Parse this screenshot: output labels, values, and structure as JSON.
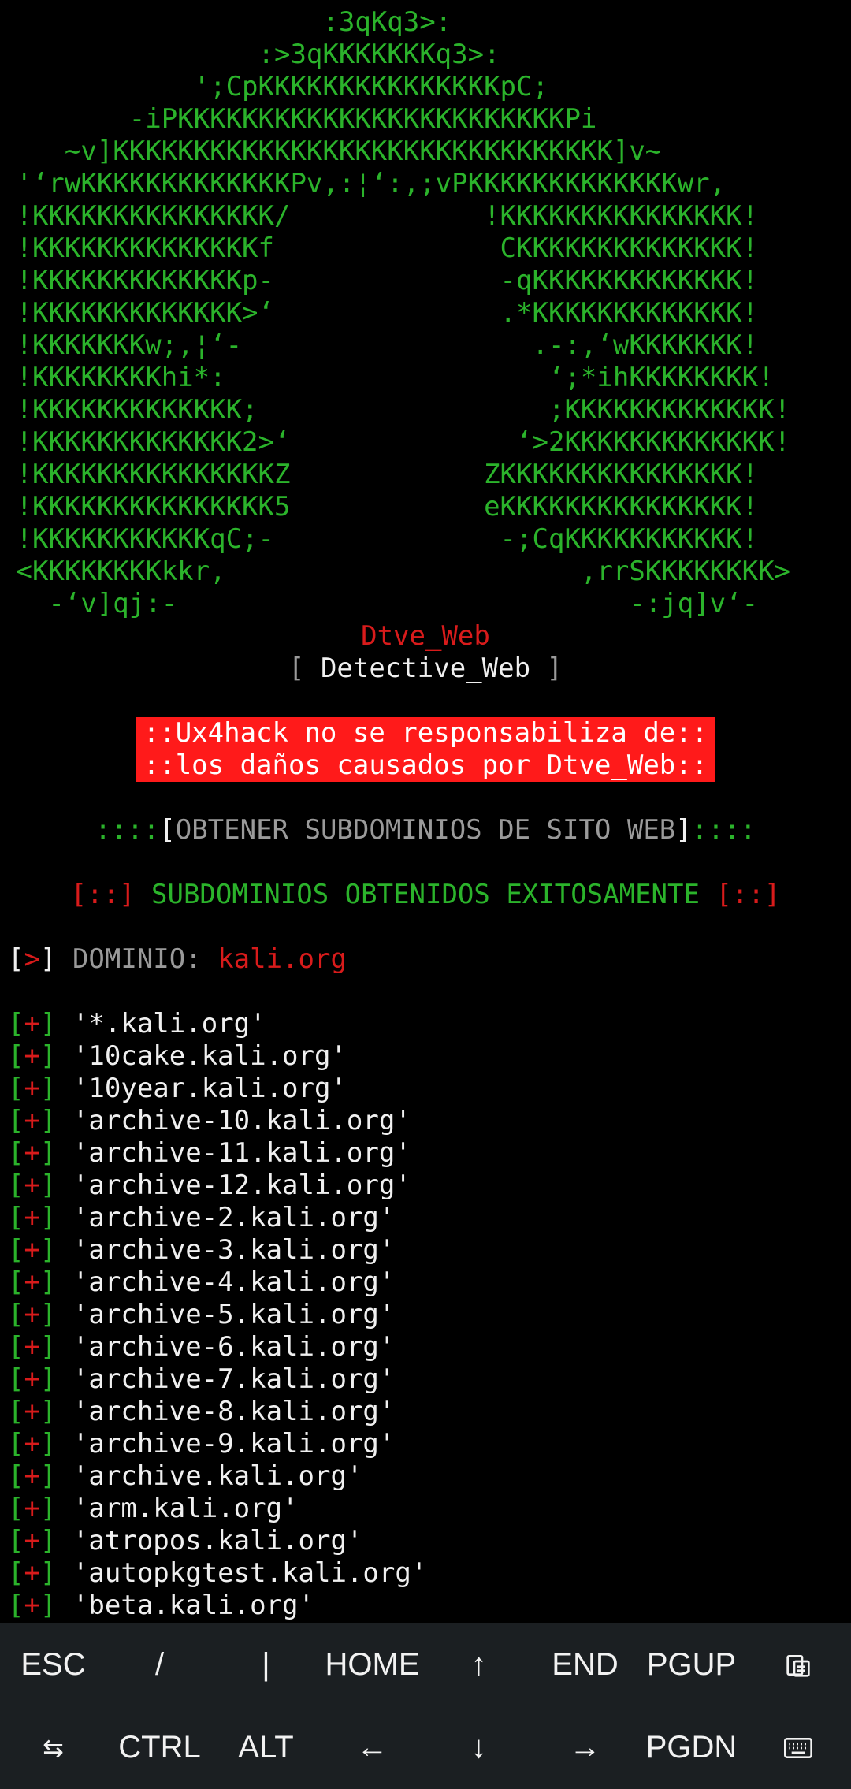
{
  "banner": {
    "art": [
      "                    :3qKq3>:",
      "                :>3qKKKKKKKq3>:",
      "            ';CpKKKKKKKKKKKKKKKpC;",
      "        -iPKKKKKKKKKKKKKKKKKKKKKKKKPi",
      "    ~v]KKKKKKKKKKKKKKKKKKKKKKKKKKKKKKK]v~",
      " '‘rwKKKKKKKKKKKKKPv,:¦‘:,;vPKKKKKKKKKKKKKwr,",
      " !KKKKKKKKKKKKKKK/            !KKKKKKKKKKKKKKK!",
      " !KKKKKKKKKKKKKKf              CKKKKKKKKKKKKKK!",
      " !KKKKKKKKKKKKKp-              -qKKKKKKKKKKKKK!",
      " !KKKKKKKKKKKKK>‘              .*KKKKKKKKKKKKK!",
      " !KKKKKKKw;,¦‘-                  .-:,‘wKKKKKKK!",
      " !KKKKKKKKhi*:                    ‘;*ihKKKKKKKK!",
      " !KKKKKKKKKKKKK;                  ;KKKKKKKKKKKKK!",
      " !KKKKKKKKKKKKK2>‘              ‘>2KKKKKKKKKKKKK!",
      " !KKKKKKKKKKKKKKKZ            ZKKKKKKKKKKKKKKK!",
      " !KKKKKKKKKKKKKKK5            eKKKKKKKKKKKKKKK!",
      " !KKKKKKKKKKKqC;-              -;CqKKKKKKKKKKK!",
      " <KKKKKKKKkkr,                      ,rrSKKKKKKKK>",
      "   -‘v]qj:-                            -:jq]v‘-"
    ],
    "tool_name": "Dtve_Web",
    "subtitle_open": "[ ",
    "subtitle": "Detective_Web",
    "subtitle_close": " ]"
  },
  "warning": {
    "line1": "::Ux4hack no se responsabiliza de::",
    "line2": "::los daños causados por Dtve_Web::"
  },
  "section": {
    "left_dots": "::::",
    "open_bracket": "[",
    "title": "OBTENER SUBDOMINIOS DE SITO WEB",
    "close_bracket": "]",
    "right_dots": "::::"
  },
  "result": {
    "left_marker": "[::]",
    "message": "SUBDOMINIOS OBTENIDOS EXITOSAMENTE",
    "right_marker": "[::]"
  },
  "domain": {
    "open_bracket": "[",
    "arrow": ">",
    "close_bracket": "]",
    "label": "DOMINIO:",
    "value": "kali.org"
  },
  "list_marker": {
    "open": "[",
    "plus": "+",
    "close": "]"
  },
  "subdomains": [
    "'*.kali.org'",
    "'10cake.kali.org'",
    "'10year.kali.org'",
    "'archive-10.kali.org'",
    "'archive-11.kali.org'",
    "'archive-12.kali.org'",
    "'archive-2.kali.org'",
    "'archive-3.kali.org'",
    "'archive-4.kali.org'",
    "'archive-5.kali.org'",
    "'archive-6.kali.org'",
    "'archive-7.kali.org'",
    "'archive-8.kali.org'",
    "'archive-9.kali.org'",
    "'archive.kali.org'",
    "'arm.kali.org'",
    "'atropos.kali.org'",
    "'autopkgtest.kali.org'",
    "'beta.kali.org'"
  ],
  "extra_keys": {
    "row1": [
      {
        "label": "ESC",
        "name": "esc-key"
      },
      {
        "label": "/",
        "name": "slash-key"
      },
      {
        "label": "|",
        "name": "pipe-key"
      },
      {
        "label": "HOME",
        "name": "home-key"
      },
      {
        "label": "↑",
        "name": "up-arrow-key"
      },
      {
        "label": "END",
        "name": "end-key"
      },
      {
        "label": "PGUP",
        "name": "pgup-key"
      },
      {
        "label": "",
        "name": "clipboard-paste-icon",
        "icon": "clipboard-paste"
      }
    ],
    "row2": [
      {
        "label": "⇆",
        "name": "tab-key-icon",
        "icon": "tab"
      },
      {
        "label": "CTRL",
        "name": "ctrl-key"
      },
      {
        "label": "ALT",
        "name": "alt-key"
      },
      {
        "label": "←",
        "name": "left-arrow-key"
      },
      {
        "label": "↓",
        "name": "down-arrow-key"
      },
      {
        "label": "→",
        "name": "right-arrow-key"
      },
      {
        "label": "PGDN",
        "name": "pgdn-key"
      },
      {
        "label": "",
        "name": "keyboard-toggle-icon",
        "icon": "keyboard"
      }
    ]
  },
  "colors": {
    "background": "#000000",
    "banner_green": "#2bb32b",
    "accent_red": "#d81b1b",
    "warning_bg": "#ff1a1a",
    "key_bar_bg": "#1b1f22"
  }
}
